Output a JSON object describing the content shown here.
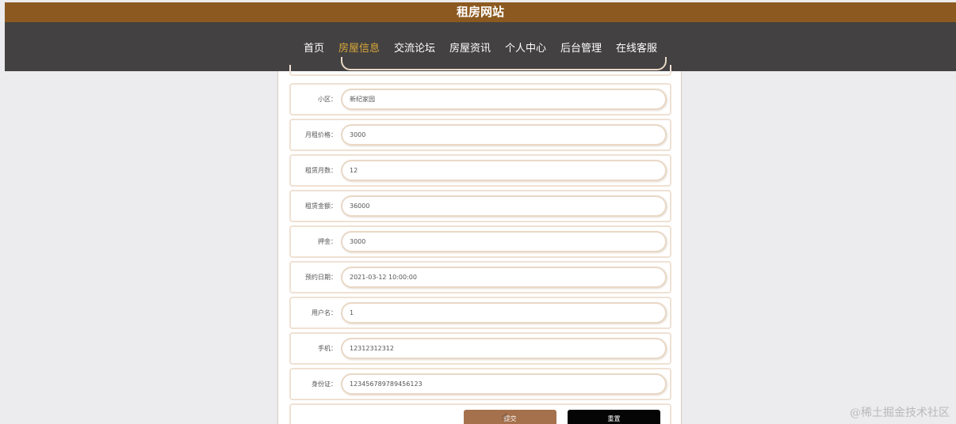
{
  "header": {
    "title": "租房网站"
  },
  "nav": [
    {
      "label": "首页",
      "active": false
    },
    {
      "label": "房屋信息",
      "active": true
    },
    {
      "label": "交流论坛",
      "active": false
    },
    {
      "label": "房屋资讯",
      "active": false
    },
    {
      "label": "个人中心",
      "active": false
    },
    {
      "label": "后台管理",
      "active": false
    },
    {
      "label": "在线客服",
      "active": false
    }
  ],
  "form": {
    "fields": [
      {
        "label": "小区：",
        "value": "新纪家园"
      },
      {
        "label": "月租价格：",
        "value": "3000"
      },
      {
        "label": "租赁月数：",
        "value": "12"
      },
      {
        "label": "租赁金额：",
        "value": "36000"
      },
      {
        "label": "押金：",
        "value": "3000"
      },
      {
        "label": "预约日期：",
        "value": "2021-03-12 10:00:00"
      },
      {
        "label": "用户名：",
        "value": "1"
      },
      {
        "label": "手机：",
        "value": "12312312312"
      },
      {
        "label": "身份证：",
        "value": "123456789789456123"
      }
    ],
    "submit_label": "提交",
    "reset_label": "重置"
  },
  "watermark": "@稀土掘金技术社区",
  "colors": {
    "title_bar": "#8c5a20",
    "nav_bar": "#434141",
    "nav_active": "#d9a83a",
    "submit_button": "#a5714d",
    "reset_button": "#050505"
  }
}
